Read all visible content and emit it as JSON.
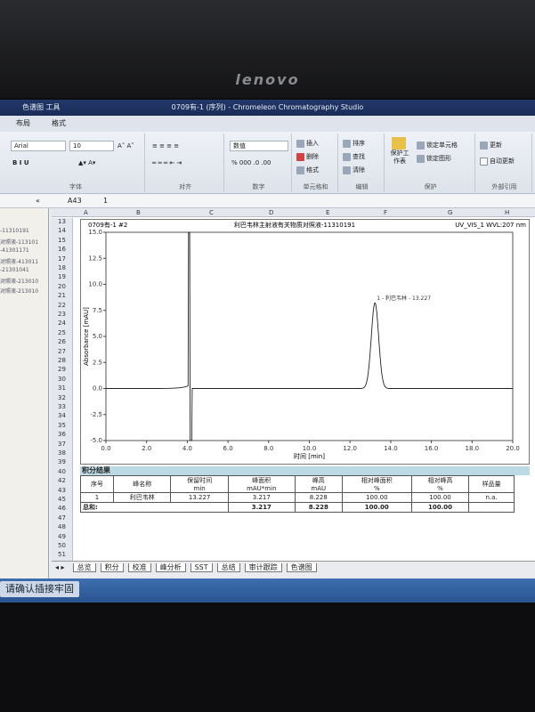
{
  "brand": "lenovo",
  "window": {
    "tools_label": "色谱图 工具",
    "title": "0709有-1 (序列) - Chromeleon Chromatography Studio"
  },
  "menu": [
    "布局",
    "格式"
  ],
  "ribbon": {
    "font_name": "Arial",
    "font_size": "10",
    "number_format": "数值",
    "groups": [
      "字体",
      "对齐",
      "数字",
      "单元格和",
      "编辑",
      "保护",
      "外部引用"
    ],
    "cells": [
      "插入",
      "删除",
      "格式"
    ],
    "edit": [
      "排序",
      "查找",
      "清除"
    ],
    "protect": [
      "保护工作表",
      "锁定单元格",
      "锁定图形"
    ],
    "external": [
      "更新",
      "自动更新"
    ]
  },
  "formula": {
    "cell_ref": "A43",
    "value": "1"
  },
  "left_pane": [
    "-11310191",
    "对照液-113101",
    "-41301171",
    "对照液-413011",
    "-21301041",
    "对照液-213010",
    "对照液-213010"
  ],
  "columns": [
    "A",
    "B",
    "C",
    "D",
    "E",
    "F",
    "G",
    "H"
  ],
  "rows": [
    "13",
    "14",
    "15",
    "16",
    "17",
    "18",
    "19",
    "20",
    "21",
    "22",
    "23",
    "24",
    "25",
    "26",
    "27",
    "28",
    "29",
    "30",
    "31",
    "32",
    "33",
    "34",
    "35",
    "36",
    "37",
    "38",
    "39",
    "40",
    "42",
    "43",
    "45",
    "46",
    "47",
    "48",
    "49",
    "50",
    "51"
  ],
  "chart_header": {
    "left": "0709有-1 #2",
    "center": "利巴韦林主射液有关物质对照液-11310191",
    "right": "UV_VIS_1 WVL:207 nm"
  },
  "chart_data": {
    "type": "line",
    "xlabel": "时间 [min]",
    "ylabel": "Absorbance [mAU]",
    "xlim": [
      0,
      20
    ],
    "ylim": [
      -5,
      15
    ],
    "xticks": [
      "0.0",
      "2.0",
      "4.0",
      "6.0",
      "8.0",
      "10.0",
      "12.0",
      "14.0",
      "16.0",
      "18.0",
      "20.0"
    ],
    "yticks": [
      "-5.0",
      "-2.5",
      "0.0",
      "2.5",
      "5.0",
      "7.5",
      "10.0",
      "12.5",
      "15.0"
    ],
    "baseline": 0,
    "solvent_front": {
      "time": 4.1,
      "max": 15,
      "min": -5
    },
    "peaks": [
      {
        "number": 1,
        "name": "利巴韦林",
        "rt": 13.227,
        "height": 8.228
      }
    ],
    "peak_label": "1 - 利巴韦林 - 13.227"
  },
  "results": {
    "title": "积分结果",
    "headers": [
      [
        "序号",
        ""
      ],
      [
        "峰名称",
        ""
      ],
      [
        "保留时间",
        "min"
      ],
      [
        "峰面积",
        "mAU*min"
      ],
      [
        "峰高",
        "mAU"
      ],
      [
        "相对峰面积",
        "%"
      ],
      [
        "相对峰高",
        "%"
      ],
      [
        "样品量",
        ""
      ]
    ],
    "rows": [
      [
        "1",
        "利巴韦林",
        "13.227",
        "3.217",
        "8.228",
        "100.00",
        "100.00",
        "n.a."
      ]
    ],
    "total_label": "总和:",
    "totals": [
      "3.217",
      "8.228",
      "100.00",
      "100.00"
    ]
  },
  "sheet_tabs": [
    "总览",
    "积分",
    "校准",
    "峰分析",
    "SST",
    "总结",
    "审计跟踪",
    "色谱图"
  ],
  "taskbar": {
    "task": "请确认插接牢固"
  }
}
